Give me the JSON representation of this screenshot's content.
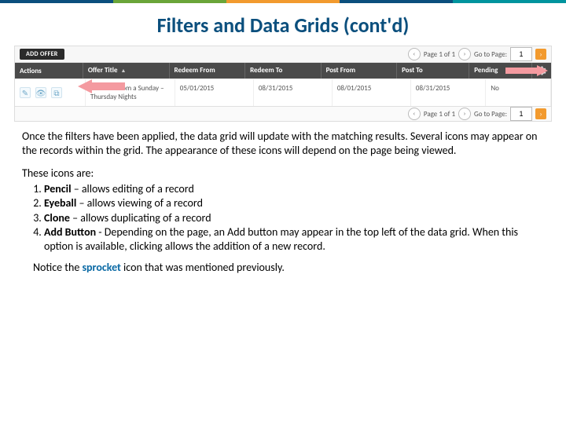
{
  "top_stripe_colors": [
    "#0b4f7d",
    "#6aa539",
    "#f29a2e",
    "#0b4f7d",
    "#00949e"
  ],
  "title": "Filters and Data Grids (cont'd)",
  "grid": {
    "add_button_label": "ADD OFFER",
    "pager": {
      "page_text": "Page 1 of 1",
      "goto_label": "Go to Page:",
      "goto_value": "1"
    },
    "headers": {
      "actions": "Actions",
      "offer_title": "Offer Title",
      "redeem_from": "Redeem From",
      "redeem_to": "Redeem To",
      "post_from": "Post From",
      "post_to": "Post To",
      "pending": "Pending"
    },
    "row": {
      "offer_title": "50% Off Room a Sunday – Thursday Nights",
      "redeem_from": "05/01/2015",
      "redeem_to": "08/31/2015",
      "post_from": "08/01/2015",
      "post_to": "08/31/2015",
      "pending": "No"
    }
  },
  "paragraph": "Once the filters have been applied, the data grid will update with the matching results. Several icons may appear on the records within the grid. The appearance of these icons will depend on the page being viewed.",
  "list_intro": "These icons are:",
  "icons_list": [
    {
      "name": "Pencil",
      "desc": " – allows editing of a record"
    },
    {
      "name": "Eyeball",
      "desc": " – allows viewing of a record"
    },
    {
      "name": "Clone",
      "desc": " – allows duplicating of a record"
    },
    {
      "name": "Add Button",
      "desc": " - Depending on the page, an Add button may appear in the top left of the data grid. When this option is available, clicking allows the addition of a new record."
    }
  ],
  "notice_pre": "Notice the ",
  "notice_word": "sprocket",
  "notice_post": " icon that was mentioned previously."
}
